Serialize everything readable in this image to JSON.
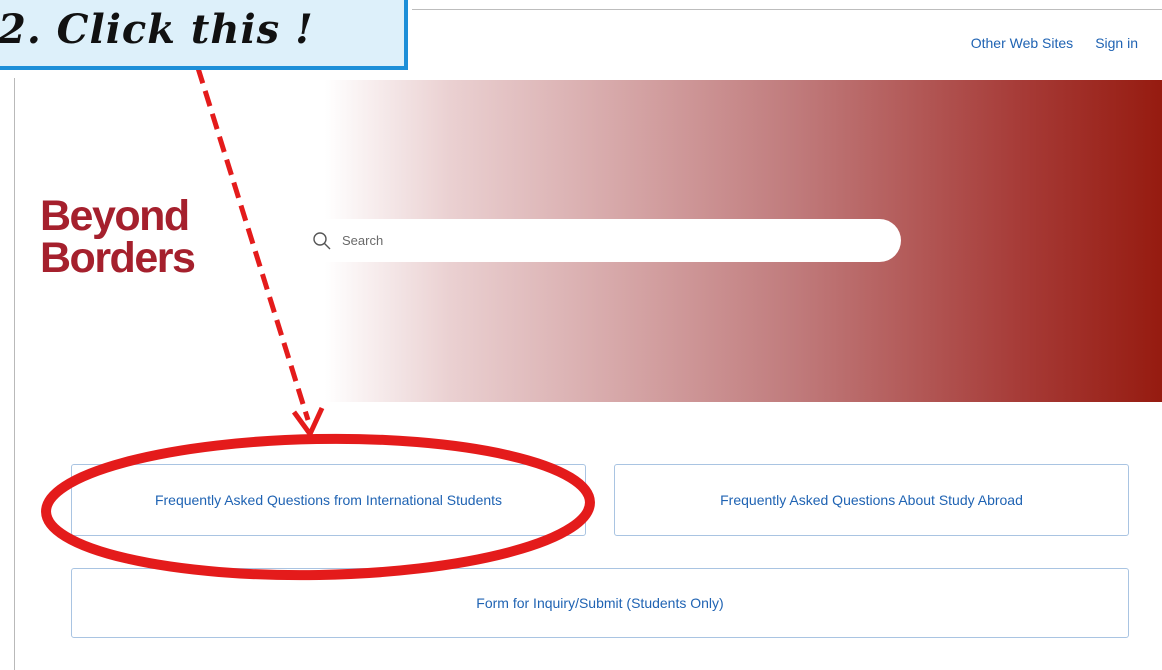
{
  "header": {
    "links": [
      "Other Web Sites",
      "Sign in"
    ]
  },
  "logo": {
    "line1": "Beyond",
    "line2": "Borders"
  },
  "search": {
    "placeholder": "Search",
    "icon": "search-icon"
  },
  "cards": [
    "Frequently Asked Questions from International Students",
    "Frequently Asked Questions About Study Abroad",
    "Form for Inquiry/Submit (Students Only)"
  ],
  "annotation": {
    "text": "2. Click this !"
  },
  "colors": {
    "brand_red": "#a5202d",
    "hero_dark": "#961b10",
    "link_blue": "#1f63b3",
    "card_border": "#a9c4e2",
    "callout_fill": "#ddf0fa",
    "callout_border": "#1d8fd8",
    "annotation_red": "#e41b1b"
  }
}
